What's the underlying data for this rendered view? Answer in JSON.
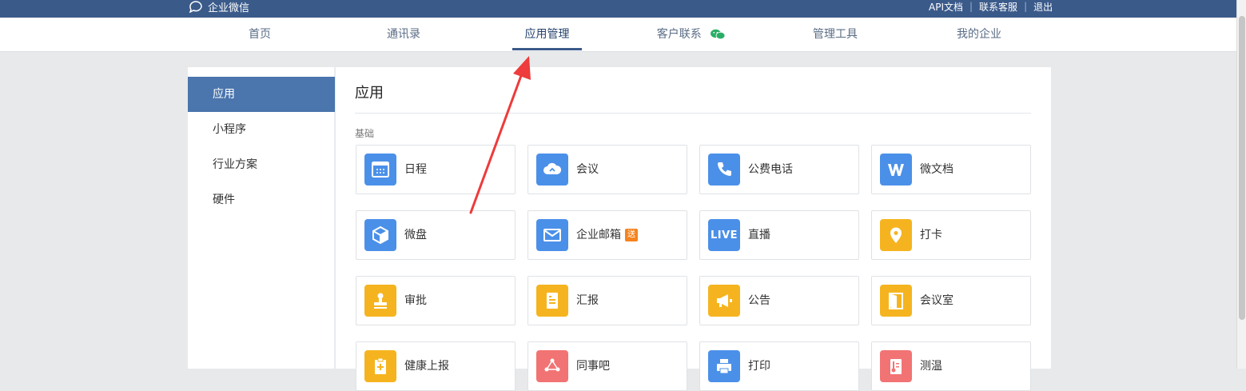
{
  "topbar": {
    "logo_text": "企业微信",
    "links": [
      "API文档",
      "联系客服",
      "退出"
    ],
    "bg": "#3a5a8a"
  },
  "nav": {
    "items": [
      "首页",
      "通讯录",
      "应用管理",
      "客户联系",
      "管理工具",
      "我的企业"
    ],
    "active": "应用管理"
  },
  "sidebar": {
    "items": [
      "应用",
      "小程序",
      "行业方案",
      "硬件"
    ],
    "active": "应用",
    "active_color": "#4a75ad"
  },
  "main": {
    "title": "应用",
    "section": "基础",
    "apps": [
      {
        "label": "日程",
        "icon": "calendar-icon",
        "color": "#4b90e8"
      },
      {
        "label": "会议",
        "icon": "cloud-icon",
        "color": "#4b90e8"
      },
      {
        "label": "公费电话",
        "icon": "phone-icon",
        "color": "#4b90e8"
      },
      {
        "label": "微文档",
        "icon": "doc-w-icon",
        "color": "#4b90e8"
      },
      {
        "label": "微盘",
        "icon": "cube-icon",
        "color": "#4b90e8"
      },
      {
        "label": "企业邮箱",
        "icon": "mail-icon",
        "color": "#4b90e8",
        "tag": "送"
      },
      {
        "label": "直播",
        "icon": "live-icon",
        "color": "#4b90e8",
        "icon_text": "LIVE"
      },
      {
        "label": "打卡",
        "icon": "location-icon",
        "color": "#f5b41f"
      },
      {
        "label": "审批",
        "icon": "stamp-icon",
        "color": "#f5b41f"
      },
      {
        "label": "汇报",
        "icon": "report-icon",
        "color": "#f5b41f"
      },
      {
        "label": "公告",
        "icon": "megaphone-icon",
        "color": "#f5b41f"
      },
      {
        "label": "会议室",
        "icon": "door-icon",
        "color": "#f5b41f"
      },
      {
        "label": "健康上报",
        "icon": "health-icon",
        "color": "#f5b41f"
      },
      {
        "label": "同事吧",
        "icon": "share-icon",
        "color": "#f27373"
      },
      {
        "label": "打印",
        "icon": "printer-icon",
        "color": "#4b90e8"
      },
      {
        "label": "测温",
        "icon": "thermometer-icon",
        "color": "#f27373"
      }
    ]
  }
}
